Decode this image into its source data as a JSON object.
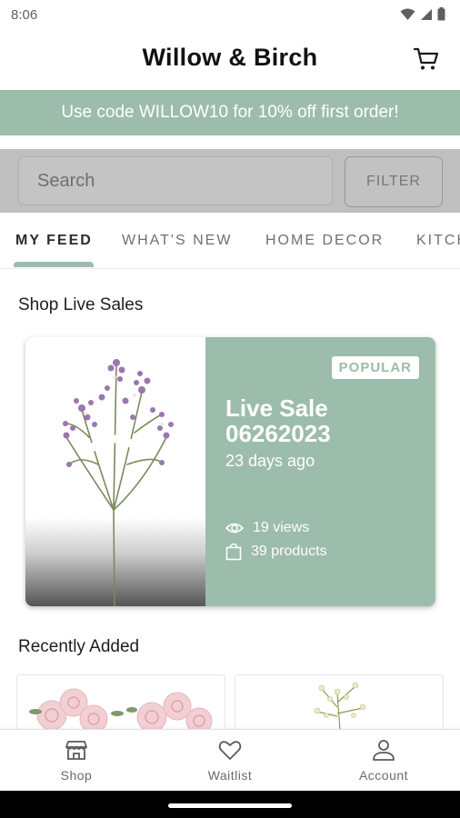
{
  "status_bar": {
    "time": "8:06"
  },
  "header": {
    "title": "Willow & Birch",
    "cart_icon": "cart-icon"
  },
  "promo": {
    "text": "Use code WILLOW10 for 10% off first order!"
  },
  "search": {
    "placeholder": "Search",
    "filter_label": "FILTER"
  },
  "tabs": [
    {
      "label": "MY FEED",
      "active": true
    },
    {
      "label": "WHAT'S NEW",
      "active": false
    },
    {
      "label": "HOME DECOR",
      "active": false
    },
    {
      "label": "KITCH",
      "active": false
    }
  ],
  "live_sales": {
    "section_title": "Shop Live Sales",
    "card": {
      "badge": "POPULAR",
      "title": "Live Sale 06262023",
      "date": "23 days ago",
      "views": "19 views",
      "products": "39 products"
    }
  },
  "recently_added": {
    "section_title": "Recently Added"
  },
  "bottom_nav": [
    {
      "label": "Shop",
      "icon": "shop-icon"
    },
    {
      "label": "Waitlist",
      "icon": "heart-icon"
    },
    {
      "label": "Account",
      "icon": "account-icon"
    }
  ],
  "colors": {
    "accent": "#9cbcac",
    "text": "#1a1a1a",
    "muted": "#6a6a6a"
  }
}
